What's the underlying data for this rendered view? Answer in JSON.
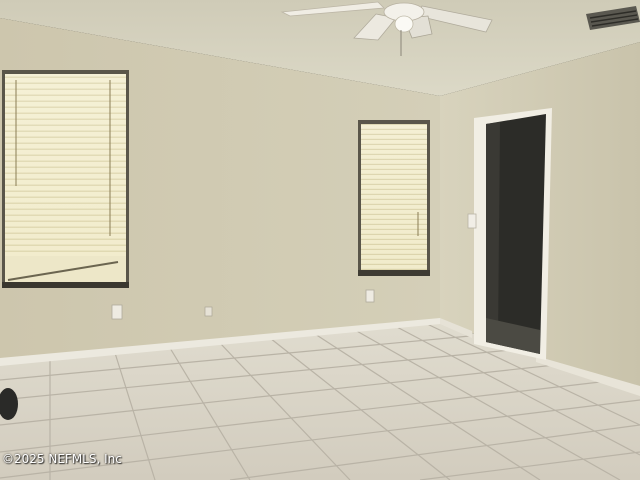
{
  "watermark": {
    "text": "©2025 NEFMLS, Inc"
  },
  "colors": {
    "ceiling": "#d8d5c2",
    "left_wall": "#d1cbb3",
    "right_wall": "#d3cfb9",
    "floor": "#ddd8cc",
    "grout": "#b8b2a6",
    "baseboard": "#ece9df",
    "window_glow": "#f6f2d6",
    "blind_slat": "#d6cfa8",
    "closet_dark": "#2c2c28"
  }
}
